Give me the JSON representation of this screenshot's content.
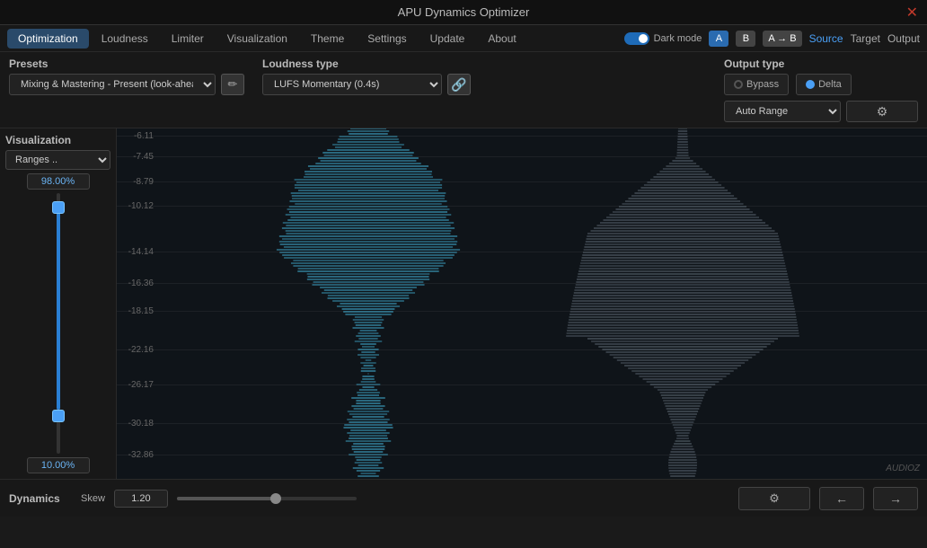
{
  "app": {
    "title": "APU Dynamics Optimizer",
    "close_btn": "✕"
  },
  "navbar": {
    "tabs": [
      {
        "label": "Optimization",
        "active": true
      },
      {
        "label": "Loudness",
        "active": false
      },
      {
        "label": "Limiter",
        "active": false
      },
      {
        "label": "Visualization",
        "active": false
      },
      {
        "label": "Theme",
        "active": false
      },
      {
        "label": "Settings",
        "active": false
      },
      {
        "label": "Update",
        "active": false
      },
      {
        "label": "About",
        "active": false
      }
    ],
    "dark_mode_label": "Dark mode",
    "btn_a_label": "A",
    "btn_b_label": "B",
    "btn_ab_label": "A → B",
    "source_label": "Source",
    "target_label": "Target",
    "output_label": "Output"
  },
  "presets": {
    "label": "Presets",
    "selected_value": "Mixing & Mastering - Present (look-ahead)",
    "edit_icon": "✏"
  },
  "loudness": {
    "label": "Loudness type",
    "selected_value": "LUFS Momentary (0.4s)",
    "link_icon": "🔗"
  },
  "output": {
    "label": "Output type",
    "bypass_label": "Bypass",
    "delta_label": "Delta",
    "range_label": "Auto Range",
    "gear_icon": "⚙"
  },
  "visualization": {
    "label": "Visualization",
    "ranges_label": "Ranges ..",
    "top_value": "98.00%",
    "bottom_value": "10.00%"
  },
  "grid": {
    "lines": [
      {
        "value": "-6.11",
        "pct": 2
      },
      {
        "value": "-7.45",
        "pct": 8
      },
      {
        "value": "-8.79",
        "pct": 15
      },
      {
        "value": "-10.12",
        "pct": 22
      },
      {
        "value": "-14.14",
        "pct": 35
      },
      {
        "value": "-16.36",
        "pct": 44
      },
      {
        "value": "-18.15",
        "pct": 52
      },
      {
        "value": "-22.16",
        "pct": 63
      },
      {
        "value": "-26.17",
        "pct": 73
      },
      {
        "value": "-30.18",
        "pct": 84
      },
      {
        "value": "-32.86",
        "pct": 93
      }
    ]
  },
  "bottom_bar": {
    "dynamics_label": "Dynamics",
    "skew_label": "Skew",
    "skew_value": "1.20",
    "gear_icon": "⚙",
    "left_arrow": "←",
    "right_arrow": "→"
  },
  "watermark": "AUDIOZ"
}
